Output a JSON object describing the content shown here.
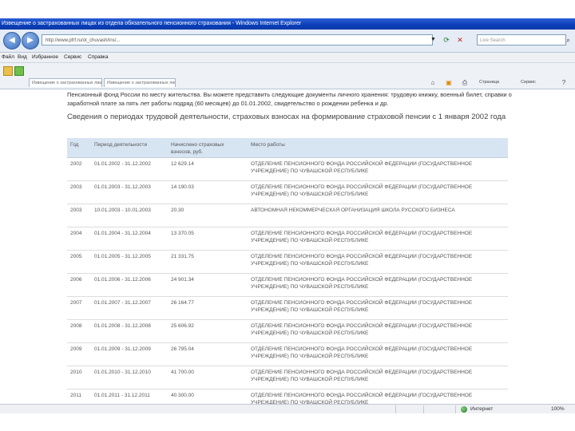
{
  "window": {
    "title": "Извещение о застрахованных лицах из отдела обязательного пенсионного страхования - Windows Internet Explorer"
  },
  "address_bar": {
    "url": "http://www.pfrf.ru/ot_chuvash/ins/...",
    "search_placeholder": "Live Search"
  },
  "menu": {
    "items": [
      "Файл",
      "Вид",
      "Избранное",
      "Сервис",
      "Справка"
    ]
  },
  "tabs": {
    "first": "Извещение о застрахованных лицах",
    "second": "Извещение о застрахованных лицах"
  },
  "toolbar": {
    "page_label": "Страница",
    "tools_label": "Сервис"
  },
  "content": {
    "intro": "Пенсионный фонд России по месту жительства. Вы можете представить следующие документы личного хранения: трудовую книжку, военный билет, справки о заработной плате за пять лет работы подряд (60 месяцев) до 01.01.2002, свидетельство о рождении ребенка и др.",
    "heading": "Сведения о периодах трудовой деятельности, страховых взносах на формирование страховой пенсии с 1 января 2002 года",
    "table": {
      "columns": [
        "Год",
        "Период деятельности",
        "Начислено страховых взносов, руб.",
        "Место работы"
      ],
      "rows": [
        {
          "year": "2002",
          "period": "01.01.2002 - 31.12.2002",
          "amount": "12 629.14",
          "employer": "ОТДЕЛЕНИЕ ПЕНСИОННОГО ФОНДА РОССИЙСКОЙ ФЕДЕРАЦИИ (ГОСУДАРСТВЕННОЕ УЧРЕЖДЕНИЕ) ПО ЧУВАШСКОЙ РЕСПУБЛИКЕ"
        },
        {
          "year": "2003",
          "period": "01.01.2003 - 31.12.2003",
          "amount": "14 190.03",
          "employer": "ОТДЕЛЕНИЕ ПЕНСИОННОГО ФОНДА РОССИЙСКОЙ ФЕДЕРАЦИИ (ГОСУДАРСТВЕННОЕ УЧРЕЖДЕНИЕ) ПО ЧУВАШСКОЙ РЕСПУБЛИКЕ"
        },
        {
          "year": "2003",
          "period": "10.01.2003 - 10.01.2003",
          "amount": "20.30",
          "employer": "АВТОНОМНАЯ НЕКОММЕРЧЕСКАЯ ОРГАНИЗАЦИЯ ШКОЛА РУССКОГО БИЗНЕСА"
        },
        {
          "year": "2004",
          "period": "01.01.2004 - 31.12.2004",
          "amount": "13 370.05",
          "employer": "ОТДЕЛЕНИЕ ПЕНСИОННОГО ФОНДА РОССИЙСКОЙ ФЕДЕРАЦИИ (ГОСУДАРСТВЕННОЕ УЧРЕЖДЕНИЕ) ПО ЧУВАШСКОЙ РЕСПУБЛИКЕ"
        },
        {
          "year": "2005",
          "period": "01.01.2005 - 31.12.2005",
          "amount": "21 331.75",
          "employer": "ОТДЕЛЕНИЕ ПЕНСИОННОГО ФОНДА РОССИЙСКОЙ ФЕДЕРАЦИИ (ГОСУДАРСТВЕННОЕ УЧРЕЖДЕНИЕ) ПО ЧУВАШСКОЙ РЕСПУБЛИКЕ"
        },
        {
          "year": "2006",
          "period": "01.01.2006 - 31.12.2006",
          "amount": "24 901.34",
          "employer": "ОТДЕЛЕНИЕ ПЕНСИОННОГО ФОНДА РОССИЙСКОЙ ФЕДЕРАЦИИ (ГОСУДАРСТВЕННОЕ УЧРЕЖДЕНИЕ) ПО ЧУВАШСКОЙ РЕСПУБЛИКЕ"
        },
        {
          "year": "2007",
          "period": "01.01.2007 - 31.12.2007",
          "amount": "26 164.77",
          "employer": "ОТДЕЛЕНИЕ ПЕНСИОННОГО ФОНДА РОССИЙСКОЙ ФЕДЕРАЦИИ (ГОСУДАРСТВЕННОЕ УЧРЕЖДЕНИЕ) ПО ЧУВАШСКОЙ РЕСПУБЛИКЕ"
        },
        {
          "year": "2008",
          "period": "01.01.2008 - 31.12.2008",
          "amount": "25 606.92",
          "employer": "ОТДЕЛЕНИЕ ПЕНСИОННОГО ФОНДА РОССИЙСКОЙ ФЕДЕРАЦИИ (ГОСУДАРСТВЕННОЕ УЧРЕЖДЕНИЕ) ПО ЧУВАШСКОЙ РЕСПУБЛИКЕ"
        },
        {
          "year": "2009",
          "period": "01.01.2009 - 31.12.2009",
          "amount": "26 795.04",
          "employer": "ОТДЕЛЕНИЕ ПЕНСИОННОГО ФОНДА РОССИЙСКОЙ ФЕДЕРАЦИИ (ГОСУДАРСТВЕННОЕ УЧРЕЖДЕНИЕ) ПО ЧУВАШСКОЙ РЕСПУБЛИКЕ"
        },
        {
          "year": "2010",
          "period": "01.01.2010 - 31.12.2010",
          "amount": "41 700.00",
          "employer": "ОТДЕЛЕНИЕ ПЕНСИОННОГО ФОНДА РОССИЙСКОЙ ФЕДЕРАЦИИ (ГОСУДАРСТВЕННОЕ УЧРЕЖДЕНИЕ) ПО ЧУВАШСКОЙ РЕСПУБЛИКЕ"
        },
        {
          "year": "2011",
          "period": "01.01.2011 - 31.12.2011",
          "amount": "40 300.00",
          "employer": "ОТДЕЛЕНИЕ ПЕНСИОННОГО ФОНДА РОССИЙСКОЙ ФЕДЕРАЦИИ (ГОСУДАРСТВЕННОЕ УЧРЕЖДЕНИЕ) ПО ЧУВАШСКОЙ РЕСПУБЛИКЕ"
        }
      ]
    }
  },
  "status_bar": {
    "zone": "Интернет",
    "zoom": "100%"
  },
  "colors": {
    "title_bar": "#0a3fb8",
    "table_header": "#d7e4f2"
  }
}
